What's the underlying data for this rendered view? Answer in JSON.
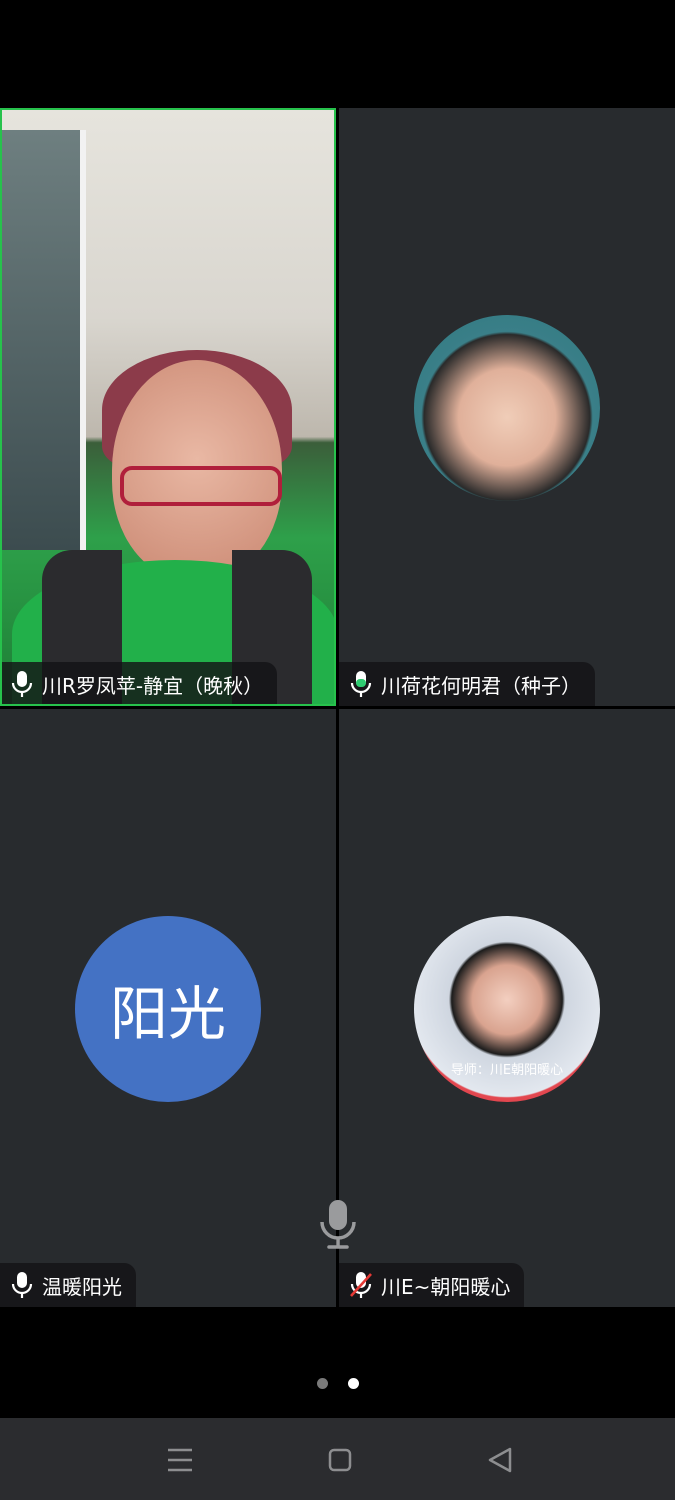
{
  "participants": [
    {
      "name": "川R罗凤苹-静宜（晚秋）",
      "mic": "on",
      "type": "video",
      "active_speaker": true
    },
    {
      "name": "川荷花何明君（种子）",
      "mic": "on",
      "type": "photo"
    },
    {
      "name": "温暖阳光",
      "mic": "on",
      "type": "text-avatar",
      "avatar_text": "阳光",
      "avatar_color": "#4472c4"
    },
    {
      "name": "川E~朝阳暖心",
      "mic": "muted",
      "type": "photo",
      "avatar_caption": "导师：川E朝阳暖心"
    }
  ],
  "pager": {
    "pages": 2,
    "current": 2
  },
  "colors": {
    "active_border": "#27c24c",
    "tile_bg": "#282b2e",
    "mic_on": "#ffffff",
    "mic_muted_slash": "#e53935"
  },
  "navbar": {
    "buttons": [
      "menu-icon",
      "home-icon",
      "back-icon"
    ]
  }
}
